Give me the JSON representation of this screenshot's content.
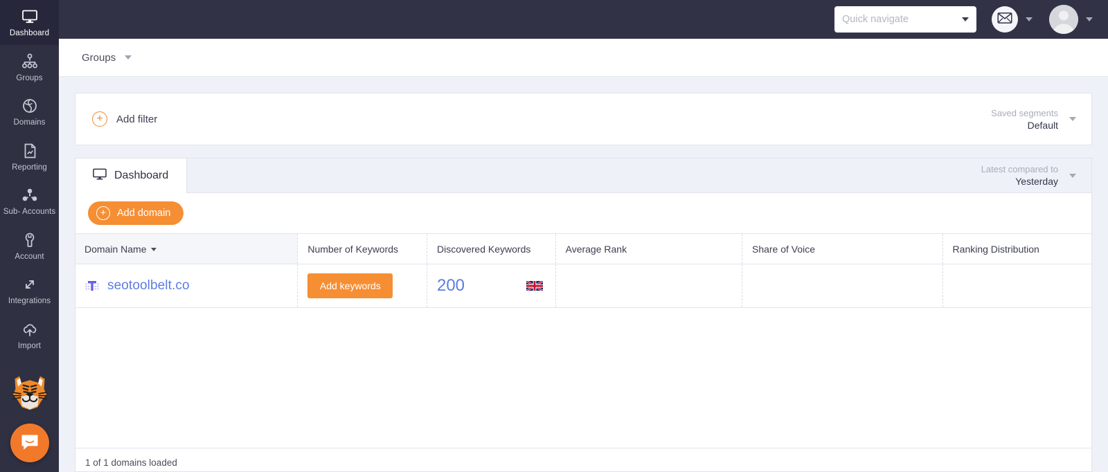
{
  "sidebar": {
    "items": [
      {
        "label": "Dashboard",
        "icon": "monitor-icon",
        "active": true
      },
      {
        "label": "Groups",
        "icon": "sitemap-icon",
        "active": false
      },
      {
        "label": "Domains",
        "icon": "globe-icon",
        "active": false
      },
      {
        "label": "Reporting",
        "icon": "report-document-icon",
        "active": false
      },
      {
        "label": "Sub-\nAccounts",
        "icon": "users-icon",
        "active": false
      },
      {
        "label": "Account",
        "icon": "wrench-icon",
        "active": false
      },
      {
        "label": "Integrations",
        "icon": "arrows-exchange-icon",
        "active": false
      },
      {
        "label": "Import",
        "icon": "cloud-upload-icon",
        "active": false
      }
    ],
    "mascot": "tiger-mascot-logo",
    "chat_launcher": "intercom-chat-icon"
  },
  "topbar": {
    "quick_navigate_placeholder": "Quick navigate",
    "quick_navigate_value": "",
    "messages_icon": "envelope-icon",
    "avatar_icon": "user-avatar-icon"
  },
  "breadcrumb": {
    "label": "Groups"
  },
  "filter_bar": {
    "add_filter_label": "Add filter",
    "saved_segments_label": "Saved segments",
    "saved_segments_value": "Default"
  },
  "panel": {
    "tab_label": "Dashboard",
    "tab_icon": "monitor-icon",
    "compare_label": "Latest compared to",
    "compare_value": "Yesterday",
    "add_domain_label": "Add domain"
  },
  "table": {
    "columns": [
      "Domain Name",
      "Number of Keywords",
      "Discovered Keywords",
      "Average Rank",
      "Share of Voice",
      "Ranking Distribution"
    ],
    "sorted_column": "Domain Name",
    "rows": [
      {
        "domain": "seotoolbelt.co",
        "favicon": "seotoolbelt-favicon",
        "number_of_keywords_action": "Add keywords",
        "discovered_keywords": "200",
        "discovered_keywords_flag": "united-kingdom-flag",
        "average_rank": "",
        "share_of_voice": "",
        "ranking_distribution": ""
      }
    ],
    "footer_note": "1 of 1 domains loaded"
  },
  "colors": {
    "accent_orange": "#f68e33",
    "sidebar_bg": "#2f3042",
    "topbar_bg": "#323247",
    "page_bg": "#eef1f7",
    "link_blue": "#5c7de0"
  }
}
